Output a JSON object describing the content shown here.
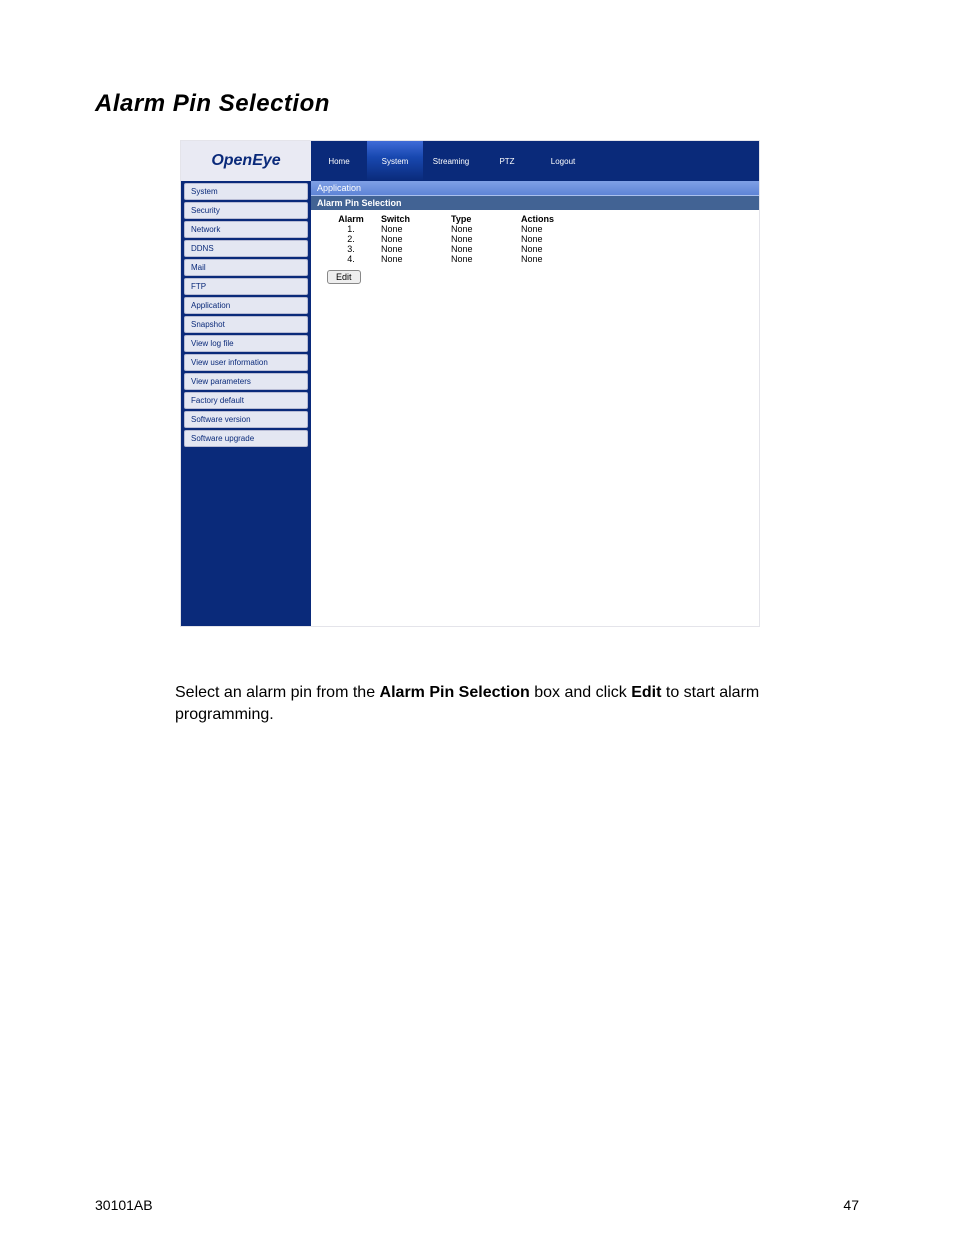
{
  "page": {
    "title": "Alarm Pin Selection",
    "doc_id": "30101AB",
    "page_no": "47"
  },
  "app": {
    "logo": "OpenEye",
    "nav": [
      "Home",
      "System",
      "Streaming",
      "PTZ",
      "Logout"
    ],
    "nav_active_index": 1,
    "sidebar": [
      "System",
      "Security",
      "Network",
      "DDNS",
      "Mail",
      "FTP",
      "Application",
      "Snapshot",
      "View log file",
      "View user information",
      "View parameters",
      "Factory default",
      "Software version",
      "Software upgrade"
    ],
    "breadcrumb": "Application",
    "section_title": "Alarm Pin Selection",
    "table": {
      "headers": {
        "alarm": "Alarm",
        "switch": "Switch",
        "type": "Type",
        "actions": "Actions"
      },
      "rows": [
        {
          "n": "1.",
          "switch": "None",
          "type": "None",
          "actions": "None"
        },
        {
          "n": "2.",
          "switch": "None",
          "type": "None",
          "actions": "None"
        },
        {
          "n": "3.",
          "switch": "None",
          "type": "None",
          "actions": "None"
        },
        {
          "n": "4.",
          "switch": "None",
          "type": "None",
          "actions": "None"
        }
      ]
    },
    "edit_label": "Edit"
  },
  "instruction": {
    "t1": "Select an alarm pin from the ",
    "b1": "Alarm Pin Selection",
    "t2": " box and click ",
    "b2": "Edit",
    "t3": " to start alarm programming."
  }
}
